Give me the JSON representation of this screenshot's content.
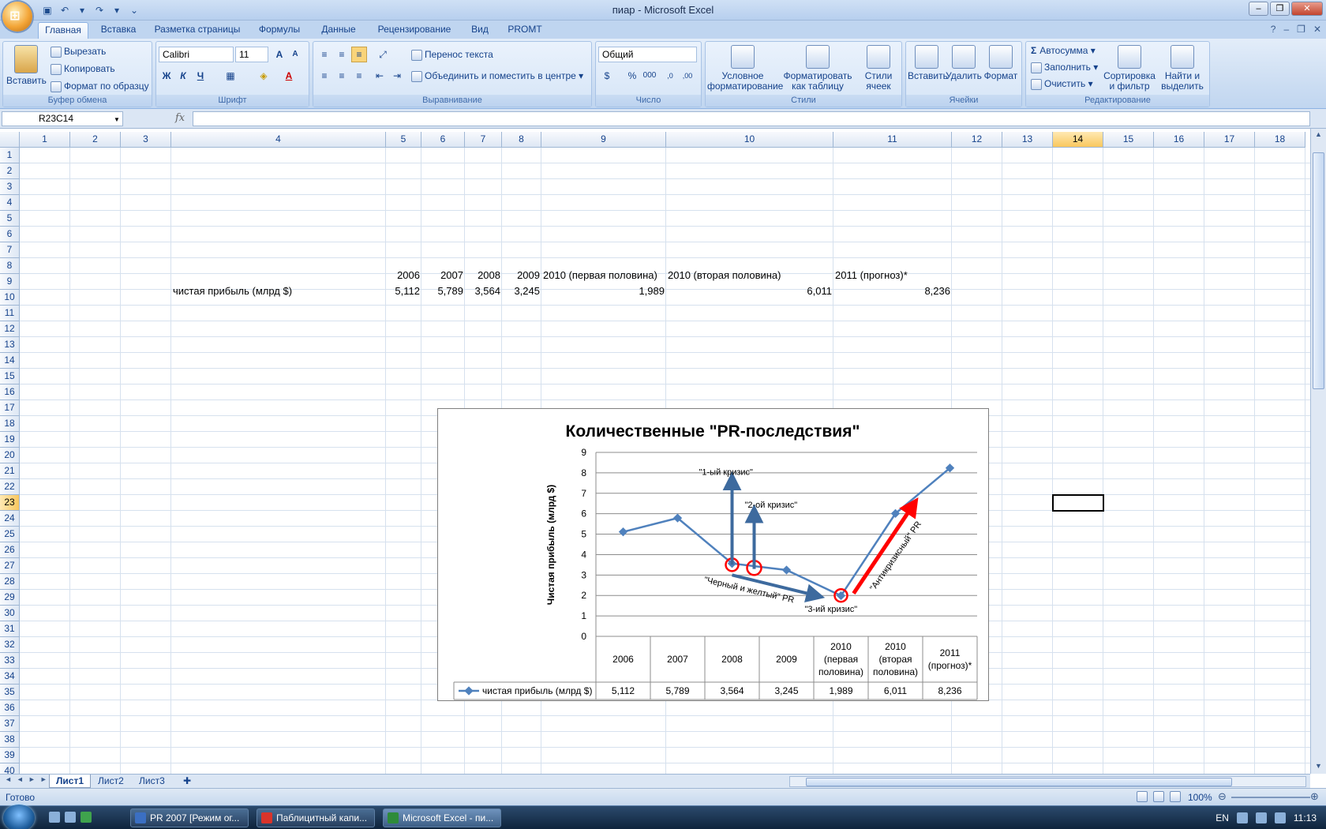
{
  "window": {
    "title": "пиар - Microsoft Excel"
  },
  "ribbon_tabs": [
    "Главная",
    "Вставка",
    "Разметка страницы",
    "Формулы",
    "Данные",
    "Рецензирование",
    "Вид",
    "PROMT"
  ],
  "clipboard": {
    "paste": "Вставить",
    "cut": "Вырезать",
    "copy": "Копировать",
    "format_painter": "Формат по образцу",
    "label": "Буфер обмена"
  },
  "font": {
    "name": "Calibri",
    "size": "11",
    "bold": "Ж",
    "italic": "К",
    "underline": "Ч",
    "label": "Шрифт"
  },
  "alignment": {
    "wrap": "Перенос текста",
    "merge": "Объединить и поместить в центре",
    "label": "Выравнивание"
  },
  "number": {
    "format": "Общий",
    "label": "Число"
  },
  "styles": {
    "conditional": "Условное форматирование",
    "as_table": "Форматировать как таблицу",
    "cell_styles": "Стили ячеек",
    "label": "Стили"
  },
  "cells": {
    "insert": "Вставить",
    "delete": "Удалить",
    "format": "Формат",
    "label": "Ячейки"
  },
  "editing": {
    "autosum": "Автосумма",
    "fill": "Заполнить",
    "clear": "Очистить",
    "sort": "Сортировка и фильтр",
    "find": "Найти и выделить",
    "label": "Редактирование"
  },
  "formula_bar": {
    "name_box": "R23C14",
    "fx": "fx",
    "formula": ""
  },
  "columns": [
    "1",
    "2",
    "3",
    "4",
    "5",
    "6",
    "7",
    "8",
    "9",
    "10",
    "11",
    "12",
    "13",
    "14",
    "15",
    "16",
    "17",
    "18"
  ],
  "selected_column": "14",
  "selected_row": "23",
  "sheet": {
    "row9": [
      "2006",
      "2007",
      "2008",
      "2009",
      "2010 (первая половина)",
      "2010 (вторая половина)",
      "2011 (прогноз)*"
    ],
    "row10_label": "чистая прибыль (млрд $)",
    "row10": [
      "5,112",
      "5,789",
      "3,564",
      "3,245",
      "1,989",
      "6,011",
      "8,236"
    ]
  },
  "chart_data": {
    "type": "line",
    "title": "Количественные \"PR-последствия\"",
    "ylabel": "Чистая прибыль (млрд $)",
    "ylim": [
      0,
      9
    ],
    "yticks": [
      "0",
      "1",
      "2",
      "3",
      "4",
      "5",
      "6",
      "7",
      "8",
      "9"
    ],
    "categories": [
      "2006",
      "2007",
      "2008",
      "2009",
      "2010 (первая половина)",
      "2010 (вторая половина)",
      "2011 (прогноз)*"
    ],
    "series": [
      {
        "name": "чистая прибыль (млрд $)",
        "values": [
          5.112,
          5.789,
          3.564,
          3.245,
          1.989,
          6.011,
          8.236
        ],
        "labels": [
          "5,112",
          "5,789",
          "3,564",
          "3,245",
          "1,989",
          "6,011",
          "8,236"
        ],
        "color": "#4f81bd"
      }
    ],
    "annotations": [
      "\"1-ый кризис\"",
      "\"2-ой кризис\"",
      "\"Черный и желтый\" PR",
      "\"3-ий кризис\"",
      "\"Антикризисный\" PR"
    ],
    "grid": true,
    "legend": "data-table"
  },
  "sheet_tabs": [
    "Лист1",
    "Лист2",
    "Лист3"
  ],
  "status": {
    "text": "Готово",
    "zoom": "100%"
  },
  "taskbar": {
    "items": [
      "PR 2007 [Режим ог...",
      "Паблицитный капи...",
      "Microsoft Excel - пи..."
    ],
    "lang": "EN",
    "clock": "11:13"
  }
}
